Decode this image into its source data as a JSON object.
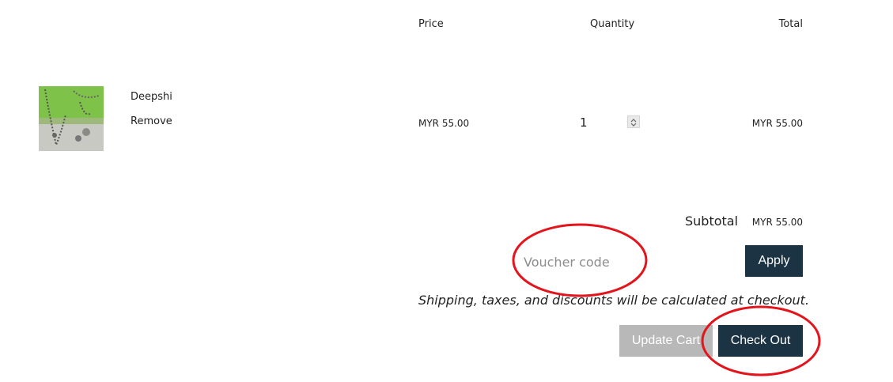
{
  "table_header": {
    "price": "Price",
    "quantity": "Quantity",
    "total": "Total"
  },
  "cart": {
    "item": {
      "name": "Deepshi",
      "remove_label": "Remove",
      "price": "MYR 55.00",
      "quantity": "1",
      "total": "MYR 55.00"
    }
  },
  "summary": {
    "subtotal_label": "Subtotal",
    "subtotal_value": "MYR 55.00"
  },
  "voucher": {
    "placeholder": "Voucher code",
    "apply_label": "Apply"
  },
  "shipping_note": "Shipping, taxes, and discounts will be calculated at checkout.",
  "actions": {
    "update_label": "Update Cart",
    "checkout_label": "Check Out"
  },
  "colors": {
    "primary_button": "#1b3342",
    "disabled_button": "#b8b8b8",
    "annotation": "#e3141c"
  }
}
